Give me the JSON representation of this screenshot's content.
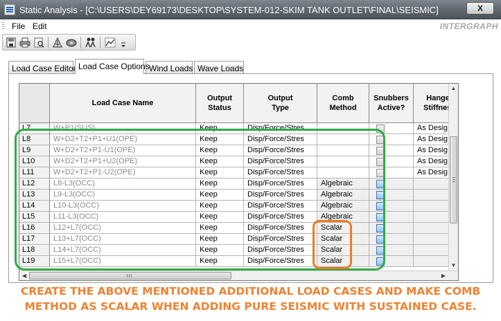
{
  "window": {
    "title": "Static Analysis - [C:\\USERS\\DEY69173\\DESKTOP\\SYSTEM-012-SKIM TANK OUTLET\\FINAL\\SEISMIC]",
    "close_label": "X",
    "brand": "INTERGRAPH"
  },
  "menu": {
    "file": "File",
    "edit": "Edit"
  },
  "toolbar": {
    "icons": [
      "save-icon",
      "print-icon",
      "print-preview-icon",
      "load-case-icon",
      "run-analysis-icon",
      "users-icon",
      "graph-icon",
      "dropdown-arrow-icon"
    ]
  },
  "tabs": [
    {
      "label": "Load Case Editor",
      "active": false
    },
    {
      "label": "Load Case Options",
      "active": true
    },
    {
      "label": "Wind Loads",
      "active": false
    },
    {
      "label": "Wave Loads",
      "active": false
    }
  ],
  "grid": {
    "columns": [
      "Load Case Name",
      "Output\nStatus",
      "Output\nType",
      "Comb\nMethod",
      "Snubbers\nActive?",
      "Hanger\nStiffness"
    ],
    "rows": [
      {
        "id": "L7",
        "name": "W+P1(SUS)",
        "status": "Keep",
        "type": "Disp/Force/Stres",
        "comb": "",
        "snubber": "grey",
        "hanger": "As Desig"
      },
      {
        "id": "L8",
        "name": "W+D2+T2+P1+U1(OPE)",
        "status": "Keep",
        "type": "Disp/Force/Stres",
        "comb": "",
        "snubber": "grey",
        "hanger": "As Desig"
      },
      {
        "id": "L9",
        "name": "W+D2+T2+P1-U1(OPE)",
        "status": "Keep",
        "type": "Disp/Force/Stres",
        "comb": "",
        "snubber": "grey",
        "hanger": "As Desig"
      },
      {
        "id": "L10",
        "name": "W+D2+T2+P1+U2(OPE)",
        "status": "Keep",
        "type": "Disp/Force/Stres",
        "comb": "",
        "snubber": "grey",
        "hanger": "As Desig"
      },
      {
        "id": "L11",
        "name": "W+D2+T2+P1-U2(OPE)",
        "status": "Keep",
        "type": "Disp/Force/Stres",
        "comb": "",
        "snubber": "grey",
        "hanger": "As Desig"
      },
      {
        "id": "L12",
        "name": "L8-L3(OCC)",
        "status": "Keep",
        "type": "Disp/Force/Stres",
        "comb": "Algebraic",
        "snubber": "blue",
        "hanger": ""
      },
      {
        "id": "L13",
        "name": "L9-L3(OCC)",
        "status": "Keep",
        "type": "Disp/Force/Stres",
        "comb": "Algebraic",
        "snubber": "blue",
        "hanger": ""
      },
      {
        "id": "L14",
        "name": "L10-L3(OCC)",
        "status": "Keep",
        "type": "Disp/Force/Stres",
        "comb": "Algebraic",
        "snubber": "blue",
        "hanger": ""
      },
      {
        "id": "L15",
        "name": "L11-L3(OCC)",
        "status": "Keep",
        "type": "Disp/Force/Stres",
        "comb": "Algebraic",
        "snubber": "blue",
        "hanger": ""
      },
      {
        "id": "L16",
        "name": "L12+L7(OCC)",
        "status": "Keep",
        "type": "Disp/Force/Stres",
        "comb": "Scalar",
        "snubber": "blue",
        "hanger": ""
      },
      {
        "id": "L17",
        "name": "L13+L7(OCC)",
        "status": "Keep",
        "type": "Disp/Force/Stres",
        "comb": "Scalar",
        "snubber": "blue",
        "hanger": ""
      },
      {
        "id": "L18",
        "name": "L14+L7(OCC)",
        "status": "Keep",
        "type": "Disp/Force/Stres",
        "comb": "Scalar",
        "snubber": "blue",
        "hanger": ""
      },
      {
        "id": "L19",
        "name": "L15+L7(OCC)",
        "status": "Keep",
        "type": "Disp/Force/Stres",
        "comb": "Scalar",
        "snubber": "blue",
        "hanger": ""
      }
    ]
  },
  "annotation": {
    "line1": "CREATE THE ABOVE MENTIONED ADDITIONAL LOAD CASES AND MAKE COMB",
    "line2": "METHOD AS SCALAR WHEN ADDING PURE SEISMIC WITH SUSTAINED CASE.",
    "highlight_green": "#2fab45",
    "highlight_orange": "#ee7a22"
  }
}
